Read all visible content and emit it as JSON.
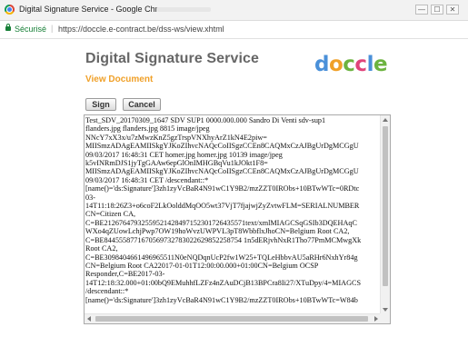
{
  "window": {
    "title": "Digital Signature Service - Google Chrome",
    "minimize_glyph": "—",
    "maximize_glyph": "☐",
    "close_glyph": "✕"
  },
  "address_bar": {
    "secure_label": "Sécurisé",
    "separator": "|",
    "url": "https://doccle.e-contract.be/dss-ws/view.xhtml"
  },
  "page": {
    "title": "Digital Signature Service",
    "view_heading": "View Document",
    "logo_letters": [
      "d",
      "o",
      "c",
      "c",
      "l",
      "e"
    ]
  },
  "buttons": {
    "sign": "Sign",
    "cancel": "Cancel"
  },
  "document": {
    "lines": [
      "Test_SDV_20170309_1647 SDV SUP1 0000.000.000 Sandro Di Venti sdv-sup1",
      "flanders.jpg flanders.jpg 8815 image/jpeg",
      "NNcY7xX3x/u7zMwzKnZ5gzTrspVNXhyArZ1kN4E2piw=",
      "MIISmzADAgEAMIISkgYJKoZIhvcNAQcCoIISgzCCEn8CAQMxCzAJBgUrDgMCGgU",
      "09/03/2017 16:48:31 CET homer.jpg homer.jpg 10139 image/jpeg",
      "k5vINRmDJS1jyTgGAAw6epGlOnIMHGBqVu1kJOkt1F8=",
      "MIISmzADAgEAMIISkgYJKoZIhvcNAQcCoIISgzCCEn8CAQMxCzAJBgUrDgMCGgU",
      "09/03/2017 16:48:31 CET /descendant::*",
      "[name()='ds:Signature']3zh1zyVcBaR4N91wC1Y9B2/mzZZT0IRObs+10BTwWTc=0RDtc",
      "03-",
      "14T11:18:26Z3+o6coF2LkOolddMqOO5wt37VjT7fjajwjZyZvtwFLM=SERIALNUMBER",
      "CN=Citizen CA,",
      "C=BE21267647932559521428497152301726435571text/xmlMIAGCSqGSIb3DQEHAqC",
      "WXo4qZUowLchjPwp7OW19hoWvzUWPVL3pT8WbbflxJhoCN=Belgium Root CA2,",
      "C=BE8445558771670569732783022629852258754 1n5dERjvhNxR1Tho77PmMCMwgXk",
      "Root CA2,",
      "C=BE3098404661496965511N0eNQDqnUcP2fw1W25+TQLeHbbvAU5aRHr6NxhYr84g",
      "CN=Belgium Root CA22017-01-01T12:00:00.000+01:00CN=Belgium OCSP",
      "Responder,C=BE2017-03-",
      "14T12:18:32.000+01:00bQ9EMuhhfLZFz4nZAuDCjB13BPCra8Ii27/XTuDpy/4=MIAGCS",
      "/descendant::*",
      "[name()='ds:Signature']3zh1zyVcBaR4N91wC1Y9B2/mzZZT0IRObs+10BTwWTc=W84b"
    ]
  }
}
